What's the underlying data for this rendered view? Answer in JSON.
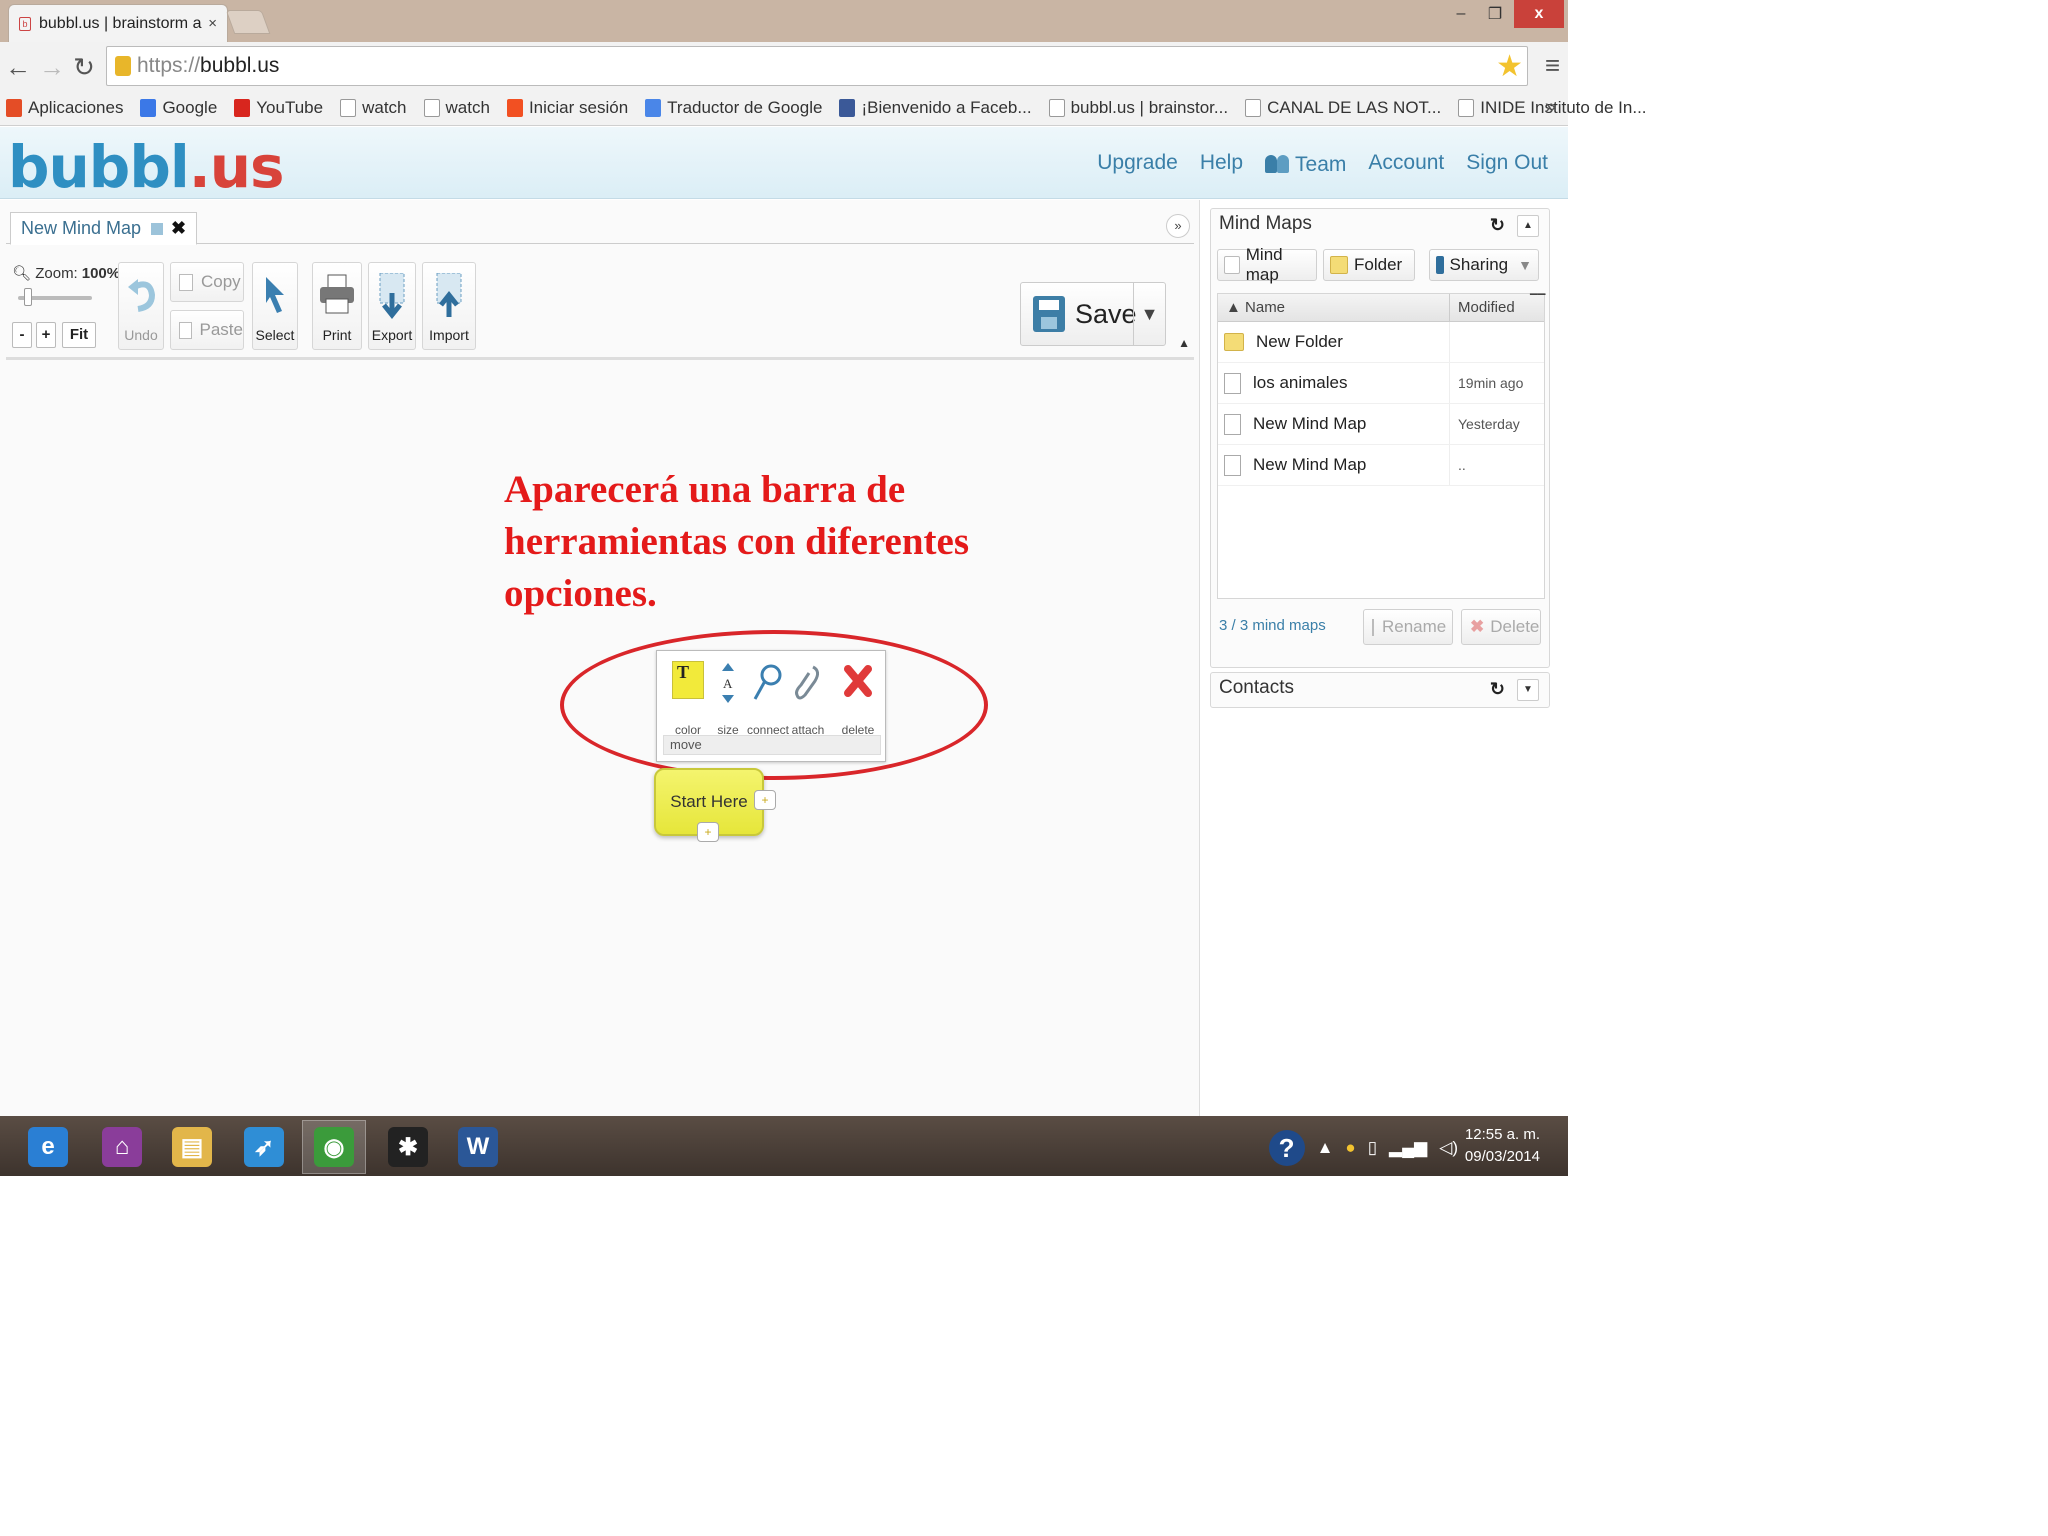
{
  "browser": {
    "tab_title": "bubbl.us | brainstorm and",
    "tab_close": "×",
    "win_min": "–",
    "win_max": "❐",
    "win_close": "x",
    "url_scheme": "https://",
    "url_host": "bubbl.us",
    "bookmarks": [
      {
        "label": "Aplicaciones",
        "icon": "apps-grid-icon",
        "color": "#e44d26"
      },
      {
        "label": "Google",
        "icon": "google-icon",
        "color": "#3b78e7"
      },
      {
        "label": "YouTube",
        "icon": "youtube-icon",
        "color": "#d8261e"
      },
      {
        "label": "watch",
        "icon": "page-icon",
        "color": "#ffffff"
      },
      {
        "label": "watch",
        "icon": "page-icon",
        "color": "#ffffff"
      },
      {
        "label": "Iniciar sesión",
        "icon": "windows-icon",
        "color": "#f25022"
      },
      {
        "label": "Traductor de Google",
        "icon": "translate-icon",
        "color": "#4a86e8"
      },
      {
        "label": "¡Bienvenido a Faceb...",
        "icon": "facebook-icon",
        "color": "#3b5998"
      },
      {
        "label": "bubbl.us | brainstor...",
        "icon": "bubblus-icon",
        "color": "#ffffff"
      },
      {
        "label": "CANAL DE LAS NOT...",
        "icon": "like-icon",
        "color": "#ffffff"
      },
      {
        "label": "INIDE Instituto de In...",
        "icon": "inide-icon",
        "color": "#ffffff"
      }
    ],
    "bookmarks_more": "»"
  },
  "app": {
    "logo_main": "bubbl",
    "logo_suffix": ".us",
    "nav": {
      "upgrade": "Upgrade",
      "help": "Help",
      "team": "Team",
      "account": "Account",
      "signout": "Sign Out"
    }
  },
  "editor": {
    "doc_tab": "New Mind Map",
    "zoom_label": "Zoom:",
    "zoom_value": "100%",
    "zoom_minus": "-",
    "zoom_plus": "+",
    "zoom_fit": "Fit",
    "tools": {
      "undo": "Undo",
      "copy": "Copy",
      "paste": "Paste",
      "select": "Select",
      "print": "Print",
      "export": "Export",
      "import": "Import",
      "save": "Save"
    }
  },
  "annotation": "Aparecerá una barra de herramientas con diferentes opciones.",
  "node_toolbar": {
    "color": "color",
    "size": "size",
    "connect": "connect",
    "attach": "attach",
    "delete": "delete",
    "move": "move",
    "color_glyph": "T",
    "size_glyph": "A"
  },
  "node": {
    "label": "Start Here"
  },
  "mind_maps_panel": {
    "title": "Mind Maps",
    "btn_mindmap": "Mind map",
    "btn_folder": "Folder",
    "btn_sharing": "Sharing",
    "col_name": "Name",
    "col_modified": "Modified",
    "rows": [
      {
        "name": "New Folder",
        "modified": "",
        "type": "folder"
      },
      {
        "name": "los animales",
        "modified": "19min ago",
        "type": "doc"
      },
      {
        "name": "New Mind Map",
        "modified": "Yesterday",
        "type": "doc"
      },
      {
        "name": "New Mind Map",
        "modified": "..",
        "type": "doc"
      }
    ],
    "count": "3 / 3 mind maps",
    "btn_rename": "Rename",
    "btn_delete": "Delete"
  },
  "contacts_panel": {
    "title": "Contacts"
  },
  "taskbar": {
    "apps": [
      {
        "name": "internet-explorer",
        "glyph": "e",
        "color": "#2a7fd4"
      },
      {
        "name": "remote",
        "glyph": "⌂",
        "color": "#8a3d9a"
      },
      {
        "name": "file-explorer",
        "glyph": "▤",
        "color": "#e2b64a"
      },
      {
        "name": "rocket",
        "glyph": "➶",
        "color": "#2f8ed6"
      },
      {
        "name": "chrome",
        "glyph": "◉",
        "color": "#3b9b3b"
      },
      {
        "name": "games",
        "glyph": "✱",
        "color": "#222222"
      },
      {
        "name": "word",
        "glyph": "W",
        "color": "#2b5797"
      }
    ],
    "clock_time": "12:55 a. m.",
    "clock_date": "09/03/2014"
  },
  "colors": {
    "accent_blue": "#3a7fa8",
    "annotation_red": "#e41a1a",
    "node_yellow": "#f4f46e"
  }
}
